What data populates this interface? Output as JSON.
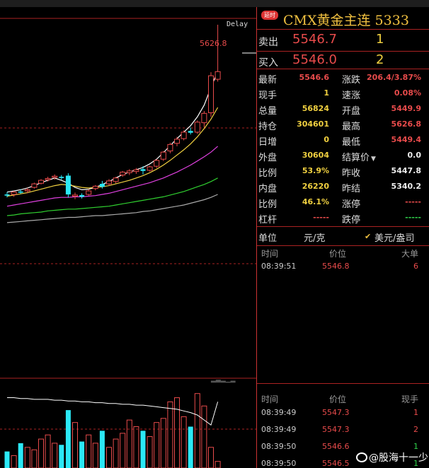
{
  "chart": {
    "delay_label": "Delay",
    "peak_label": "5626.8",
    "watermark": "▂▃▂▁▂"
  },
  "colors": {
    "up": "#e84b4b",
    "down": "#2be8f5",
    "ma5": "#ffffff",
    "ma10": "#f0d040",
    "ma20": "#e040e0",
    "ma40": "#30d030",
    "ma60": "#aaaaaa"
  },
  "chart_data": {
    "type": "candlestick",
    "ylim": [
      5320,
      5640
    ],
    "candles": [
      {
        "o": 5338,
        "h": 5342,
        "l": 5333,
        "c": 5336
      },
      {
        "o": 5338,
        "h": 5344,
        "l": 5334,
        "c": 5342
      },
      {
        "o": 5343,
        "h": 5347,
        "l": 5339,
        "c": 5341
      },
      {
        "o": 5344,
        "h": 5349,
        "l": 5340,
        "c": 5346
      },
      {
        "o": 5350,
        "h": 5358,
        "l": 5348,
        "c": 5356
      },
      {
        "o": 5357,
        "h": 5364,
        "l": 5355,
        "c": 5362
      },
      {
        "o": 5363,
        "h": 5368,
        "l": 5360,
        "c": 5365
      },
      {
        "o": 5367,
        "h": 5372,
        "l": 5363,
        "c": 5369
      },
      {
        "o": 5368,
        "h": 5371,
        "l": 5363,
        "c": 5366
      },
      {
        "o": 5370,
        "h": 5374,
        "l": 5333,
        "c": 5338
      },
      {
        "o": 5335,
        "h": 5341,
        "l": 5330,
        "c": 5337
      },
      {
        "o": 5337,
        "h": 5340,
        "l": 5331,
        "c": 5334
      },
      {
        "o": 5338,
        "h": 5347,
        "l": 5336,
        "c": 5344
      },
      {
        "o": 5348,
        "h": 5354,
        "l": 5345,
        "c": 5352
      },
      {
        "o": 5356,
        "h": 5361,
        "l": 5348,
        "c": 5351
      },
      {
        "o": 5356,
        "h": 5364,
        "l": 5353,
        "c": 5361
      },
      {
        "o": 5360,
        "h": 5368,
        "l": 5357,
        "c": 5366
      },
      {
        "o": 5371,
        "h": 5378,
        "l": 5368,
        "c": 5376
      },
      {
        "o": 5375,
        "h": 5381,
        "l": 5371,
        "c": 5378
      },
      {
        "o": 5377,
        "h": 5383,
        "l": 5373,
        "c": 5380
      },
      {
        "o": 5381,
        "h": 5386,
        "l": 5372,
        "c": 5378
      },
      {
        "o": 5379,
        "h": 5387,
        "l": 5377,
        "c": 5385
      },
      {
        "o": 5386,
        "h": 5398,
        "l": 5383,
        "c": 5396
      },
      {
        "o": 5398,
        "h": 5412,
        "l": 5395,
        "c": 5410
      },
      {
        "o": 5412,
        "h": 5426,
        "l": 5408,
        "c": 5423
      },
      {
        "o": 5425,
        "h": 5436,
        "l": 5420,
        "c": 5432
      },
      {
        "o": 5433,
        "h": 5447,
        "l": 5430,
        "c": 5444
      },
      {
        "o": 5446,
        "h": 5452,
        "l": 5440,
        "c": 5443
      },
      {
        "o": 5444,
        "h": 5464,
        "l": 5441,
        "c": 5461
      },
      {
        "o": 5460,
        "h": 5480,
        "l": 5452,
        "c": 5476
      },
      {
        "o": 5477,
        "h": 5546,
        "l": 5470,
        "c": 5540
      },
      {
        "o": 5534,
        "h": 5626.8,
        "l": 5530,
        "c": 5547
      }
    ],
    "ma_lines": [
      {
        "key": "ma5",
        "values": [
          5342,
          5344,
          5346,
          5349,
          5353,
          5358,
          5362,
          5366,
          5362,
          5357,
          5350,
          5346,
          5347,
          5350,
          5355,
          5360,
          5366,
          5372,
          5376,
          5380,
          5384,
          5390,
          5398,
          5409,
          5421,
          5433,
          5444,
          5455,
          5470,
          5490,
          5520,
          5548
        ]
      },
      {
        "key": "ma10",
        "values": [
          5335,
          5337,
          5339,
          5341,
          5344,
          5347,
          5350,
          5353,
          5355,
          5354,
          5352,
          5350,
          5349,
          5350,
          5351,
          5353,
          5356,
          5359,
          5362,
          5366,
          5370,
          5375,
          5381,
          5388,
          5396,
          5405,
          5414,
          5424,
          5436,
          5450,
          5466,
          5486
        ]
      },
      {
        "key": "ma20",
        "values": [
          5318,
          5320,
          5322,
          5324,
          5326,
          5328,
          5330,
          5332,
          5333,
          5333,
          5334,
          5334,
          5335,
          5336,
          5338,
          5340,
          5343,
          5346,
          5349,
          5352,
          5355,
          5358,
          5362,
          5366,
          5371,
          5376,
          5382,
          5388,
          5395,
          5402,
          5410,
          5420
        ]
      },
      {
        "key": "ma40",
        "values": [
          5302,
          5303,
          5305,
          5306,
          5307,
          5308,
          5310,
          5311,
          5312,
          5313,
          5313,
          5314,
          5315,
          5316,
          5317,
          5318,
          5320,
          5322,
          5324,
          5326,
          5328,
          5330,
          5332,
          5334,
          5337,
          5340,
          5343,
          5347,
          5351,
          5355,
          5360,
          5366
        ]
      },
      {
        "key": "ma60",
        "values": [
          5290,
          5291,
          5292,
          5293,
          5294,
          5295,
          5296,
          5297,
          5298,
          5299,
          5299,
          5300,
          5301,
          5302,
          5302,
          5303,
          5304,
          5305,
          5306,
          5307,
          5309,
          5310,
          5312,
          5314,
          5316,
          5318,
          5320,
          5323,
          5326,
          5329,
          5333,
          5338
        ]
      }
    ],
    "volume": {
      "ylim": [
        0,
        100
      ],
      "values": [
        20,
        15,
        30,
        25,
        22,
        35,
        40,
        30,
        28,
        70,
        55,
        32,
        40,
        30,
        45,
        25,
        35,
        42,
        58,
        50,
        45,
        38,
        55,
        60,
        80,
        85,
        62,
        50,
        90,
        75,
        25,
        8
      ],
      "line": [
        85,
        85,
        84,
        84,
        83,
        83,
        83,
        82,
        82,
        81,
        81,
        80,
        80,
        79,
        79,
        78,
        78,
        77,
        77,
        76,
        76,
        75,
        74,
        73,
        72,
        71,
        69,
        67,
        64,
        58,
        52,
        80
      ]
    }
  },
  "panel": {
    "badge": "延时",
    "title": "CMX黄金主连 5333",
    "sell": {
      "label": "卖出",
      "price": "5546.7",
      "vol": "1"
    },
    "buy": {
      "label": "买入",
      "price": "5546.0",
      "vol": "2"
    },
    "stats": [
      {
        "l1": "最新",
        "v1": "5546.6",
        "c1": "red",
        "l2": "涨跌",
        "v2": "206.4/3.87%",
        "c2": "red"
      },
      {
        "l1": "现手",
        "v1": "1",
        "c1": "yel",
        "l2": "速涨",
        "v2": "0.08%",
        "c2": "red"
      },
      {
        "l1": "总量",
        "v1": "56824",
        "c1": "yel",
        "l2": "开盘",
        "v2": "5449.9",
        "c2": "red"
      },
      {
        "l1": "持仓",
        "v1": "304601",
        "c1": "yel",
        "l2": "最高",
        "v2": "5626.8",
        "c2": "red"
      },
      {
        "l1": "日增",
        "v1": "0",
        "c1": "yel",
        "l2": "最低",
        "v2": "5449.4",
        "c2": "red"
      },
      {
        "l1": "外盘",
        "v1": "30604",
        "c1": "yel",
        "l2": "结算价",
        "v2": "0.0",
        "c2": "wht"
      },
      {
        "l1": "比例",
        "v1": "53.9%",
        "c1": "yel",
        "l2": "昨收",
        "v2": "5447.8",
        "c2": "wht"
      },
      {
        "l1": "内盘",
        "v1": "26220",
        "c1": "yel",
        "l2": "昨结",
        "v2": "5340.2",
        "c2": "wht"
      },
      {
        "l1": "比例",
        "v1": "46.1%",
        "c1": "yel",
        "l2": "涨停",
        "v2": "-----",
        "c2": "red"
      },
      {
        "l1": "杠杆",
        "v1": "-----",
        "c1": "red",
        "l2": "跌停",
        "v2": "-----",
        "c2": "grn"
      }
    ],
    "unit": {
      "label": "单位",
      "value": "元/克",
      "check": "✔",
      "alt": "美元/盎司"
    },
    "ticks1": {
      "headers": [
        "时间",
        "价位",
        "大单"
      ],
      "rows": [
        {
          "time": "08:39:51",
          "price": "5546.8",
          "vol": "6",
          "vc": "red"
        }
      ]
    },
    "ticks2": {
      "headers": [
        "时间",
        "价位",
        "现手"
      ],
      "rows": [
        {
          "time": "08:39:49",
          "price": "5547.3",
          "vol": "1",
          "vc": "red"
        },
        {
          "time": "08:39:49",
          "price": "5547.3",
          "vol": "2",
          "vc": "red"
        },
        {
          "time": "08:39:50",
          "price": "5546.6",
          "vol": "1",
          "vc": "grn"
        },
        {
          "time": "08:39:50",
          "price": "5546.5",
          "vol": "1",
          "vc": "grn"
        }
      ]
    }
  },
  "footer": {
    "weibo": "@股海十一少"
  }
}
